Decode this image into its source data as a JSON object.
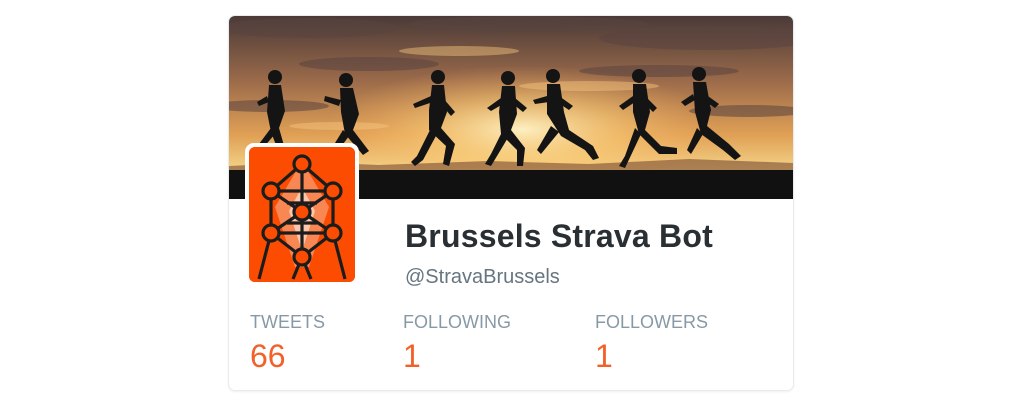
{
  "profile": {
    "name": "Brussels Strava Bot",
    "handle": "@StravaBrussels"
  },
  "stats": {
    "tweets": {
      "label": "TWEETS",
      "value": "66"
    },
    "following": {
      "label": "FOLLOWING",
      "value": "1"
    },
    "followers": {
      "label": "FOLLOWERS",
      "value": "1"
    }
  },
  "banner": {
    "subject": "silhouettes of runners against an orange sunset sky"
  },
  "avatar": {
    "subject": "Atomium line drawing on orange background"
  },
  "colors": {
    "accent": "#f2612a",
    "strava_orange": "#fc4c02",
    "name_text": "#292f33",
    "muted_text": "#66757f",
    "stat_label": "#8899a6"
  }
}
